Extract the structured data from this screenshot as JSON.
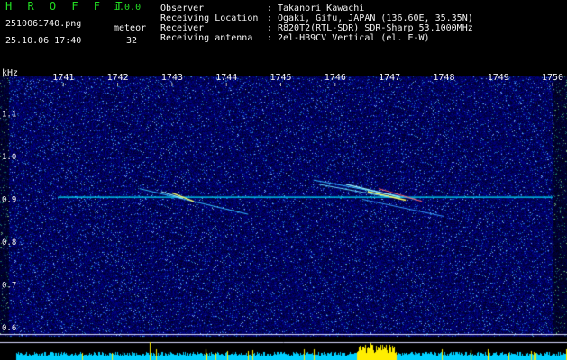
{
  "app": {
    "title": "H R O F F T",
    "version": "1.0.0"
  },
  "capture": {
    "filename": "2510061740.png",
    "datetime": "25.10.06 17:40",
    "meteor_label": "meteor",
    "meteor_count": "32"
  },
  "station": [
    {
      "label": "Observer",
      "sep": ":",
      "value": "Takanori Kawachi"
    },
    {
      "label": "Receiving Location",
      "sep": ":",
      "value": "Ogaki, Gifu, JAPAN (136.60E, 35.35N)"
    },
    {
      "label": "Receiver",
      "sep": ":",
      "value": "R820T2(RTL-SDR) SDR-Sharp 53.1000MHz"
    },
    {
      "label": "Receiving antenna",
      "sep": ":",
      "value": "2el-HB9CV Vertical (el. E-W)"
    }
  ],
  "axes": {
    "y_unit": "kHz",
    "y_ticks": [
      "1.1",
      "1.0",
      "0.9",
      "0.8",
      "0.7",
      "0.6"
    ],
    "y_values": [
      1.1,
      1.0,
      0.9,
      0.8,
      0.7,
      0.6
    ],
    "y_range": [
      0.6,
      1.2
    ],
    "x_ticks": [
      "1741",
      "1742",
      "1743",
      "1744",
      "1745",
      "1746",
      "1747",
      "1748",
      "1749",
      "1750"
    ],
    "x_values": [
      1741,
      1742,
      1743,
      1744,
      1745,
      1746,
      1747,
      1748,
      1749,
      1750
    ],
    "x_range": [
      1740,
      1750
    ]
  },
  "colors": {
    "background": "#000000",
    "noise": "#0a0a7a",
    "signal": "#00e5ff",
    "meteor_core": "#ffff66",
    "title": "#22dd22",
    "text": "#f2f2f2",
    "bar_level": "#00d0ff"
  }
}
